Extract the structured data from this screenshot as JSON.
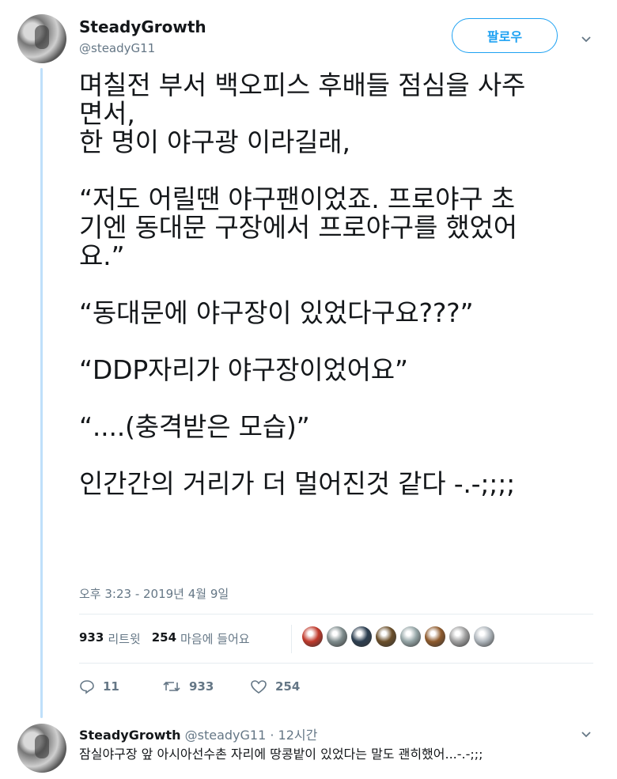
{
  "tweet": {
    "display_name": "SteadyGrowth",
    "handle": "@steadyG11",
    "follow_label": "팔로우",
    "text": "며칠전 부서 백오피스 후배들 점심을 사주\n면서,\n한 명이 야구광 이라길래,\n\n“저도 어릴땐 야구팬이었죠. 프로야구 초\n기엔 동대문 구장에서 프로야구를 했었어\n요.”\n\n“동대문에 야구장이 있었다구요???”\n\n“DDP자리가 야구장이었어요”\n\n“....(충격받은 모습)”\n\n인간간의 거리가 더 멀어진것 같다 -.-;;;;",
    "timestamp": "오후 3:23 - 2019년 4월 9일",
    "retweet_count": "933",
    "retweet_label": "리트윗",
    "like_count": "254",
    "like_label": "마음에 들어요",
    "actions": {
      "reply": "11",
      "retweet": "933",
      "like": "254"
    },
    "liker_colors": [
      "#c0392b",
      "#7f8c8d",
      "#2c3e50",
      "#6b4f2a",
      "#95a5a6",
      "#8e5a2c",
      "#a0a0a0",
      "#b0b7bd"
    ]
  },
  "reply": {
    "display_name": "SteadyGrowth",
    "handle": "@steadyG11",
    "time": "· 12시간",
    "text": "잠실야구장 앞 아시아선수촌 자리에 땅콩밭이 있었다는 말도 괜히했어...-.-;;;"
  }
}
